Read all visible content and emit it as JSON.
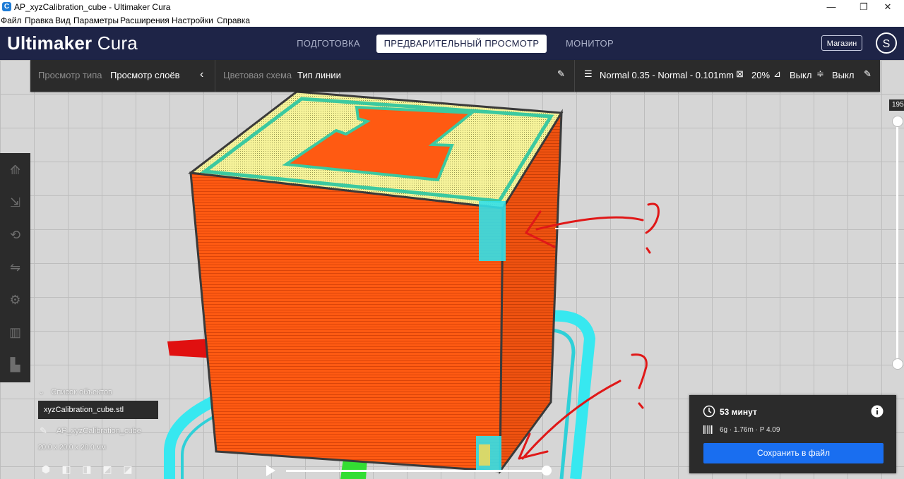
{
  "window": {
    "title": "AP_xyzCalibration_cube - Ultimaker Cura",
    "app_icon": "C",
    "minimize": "—",
    "restore": "❐",
    "close": "✕"
  },
  "menu": [
    "Файл",
    "Правка",
    "Вид",
    "Параметры",
    "Расширения",
    "Настройки",
    "Справка"
  ],
  "header": {
    "logo_bold": "Ultimaker",
    "logo_thin": "Cura",
    "stages": [
      "ПОДГОТОВКА",
      "ПРЕДВАРИТЕЛЬНЫЙ ПРОСМОТР",
      "МОНИТОР"
    ],
    "active_stage": "ПРЕДВАРИТЕЛЬНЫЙ ПРОСМОТР",
    "marketplace": "Магазин",
    "avatar_letter": "S"
  },
  "view_bar": {
    "view_type_label": "Просмотр типа",
    "view_type_value": "Просмотр слоёв",
    "color_scheme_label": "Цветовая схема",
    "color_scheme_value": "Тип линии",
    "profile": "Normal 0.35 - Normal - 0.101mm",
    "infill": "20%",
    "support": "Выкл",
    "adhesion": "Выкл"
  },
  "layer_slider": {
    "current_layer": "195"
  },
  "objects": {
    "header": "Список объектов",
    "file": "xyzCalibration_cube.stl",
    "job_name": "AP_xyzCalibration_cube",
    "dimensions": "20.0 x 20.0 x 20.0 мм"
  },
  "print_info": {
    "time": "53 минут",
    "material": "6g · 1.76m · P 4.09",
    "save_label": "Сохранить в файл"
  },
  "colors": {
    "header_bg": "#1e2447",
    "panel_bg": "#2b2b2b",
    "accent": "#196ef0",
    "wall_orange": "#ff5a12",
    "top_yellow": "#f6f39a",
    "skirt_cyan": "#37e8f0",
    "annotation_red": "#e01818"
  },
  "icons": [
    "clock-icon",
    "info-icon",
    "filament-icon",
    "pencil-icon",
    "infill-icon",
    "support-icon",
    "adhesion-icon"
  ]
}
